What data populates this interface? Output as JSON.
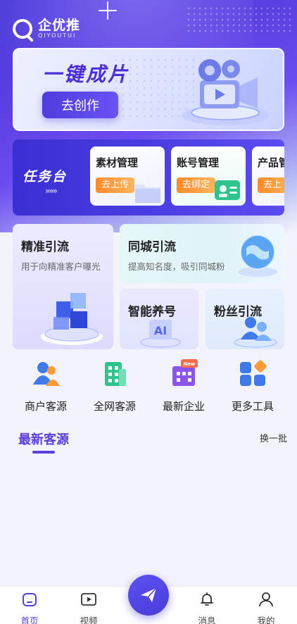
{
  "app": {
    "name": "企优推",
    "name_en": "QIYOUTUI"
  },
  "banner": {
    "title": "一键成片",
    "button": "去创作"
  },
  "task": {
    "label": "任务台",
    "arrows": "»»»",
    "cards": [
      {
        "title": "素材管理",
        "button": "去上传"
      },
      {
        "title": "账号管理",
        "button": "去绑定"
      },
      {
        "title": "产品管",
        "button": "去上传"
      }
    ]
  },
  "features": {
    "precise": {
      "title": "精准引流",
      "subtitle": "用于向精准客户曝光"
    },
    "local": {
      "title": "同城引流",
      "subtitle": "提高知名度，吸引同城粉"
    },
    "smart": {
      "title": "智能养号"
    },
    "fans": {
      "title": "粉丝引流"
    }
  },
  "quick_links": [
    {
      "label": "商户客源",
      "icon": "users-icon"
    },
    {
      "label": "全网客源",
      "icon": "building-icon"
    },
    {
      "label": "最新企业",
      "icon": "new-company-icon"
    },
    {
      "label": "更多工具",
      "icon": "grid-icon"
    }
  ],
  "section": {
    "title": "最新客源",
    "action": "换一批"
  },
  "tabbar": {
    "items": [
      {
        "label": "首页",
        "icon": "home-icon"
      },
      {
        "label": "视频",
        "icon": "video-icon"
      },
      {
        "label": "消息",
        "icon": "bell-icon"
      },
      {
        "label": "我的",
        "icon": "user-icon"
      }
    ],
    "fab_icon": "send-icon"
  },
  "colors": {
    "primary": "#5b3fd8",
    "accent_orange": "#ff8a2b",
    "green": "#2fc48d"
  }
}
